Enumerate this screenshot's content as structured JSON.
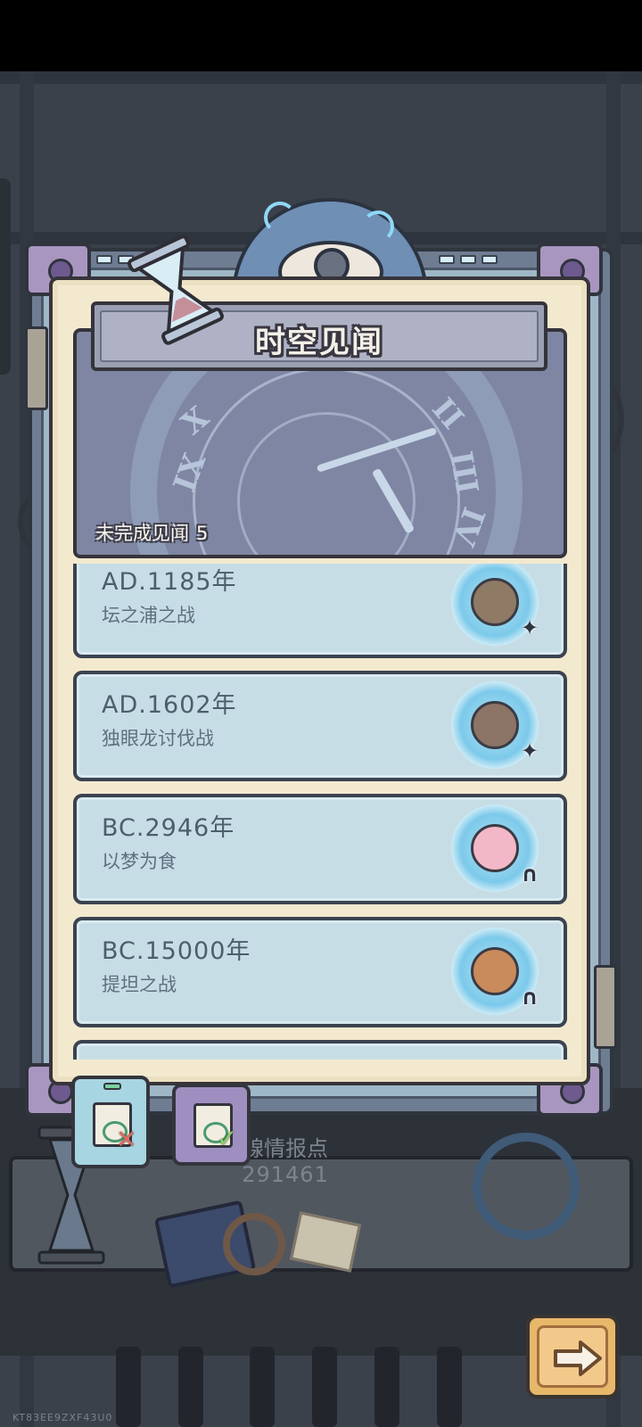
{
  "panel": {
    "title": "时空见闻",
    "incomplete_label": "未完成见闻",
    "incomplete_count": "5"
  },
  "events": [
    {
      "year": "AD.1185年",
      "name": "坛之浦之战",
      "avatar": "samurai-warrior-avatar",
      "type_icon": "shuriken-icon",
      "avatar_color": "#8f7a66"
    },
    {
      "year": "AD.1602年",
      "name": "独眼龙讨伐战",
      "avatar": "one-eyed-warlord-avatar",
      "type_icon": "shuriken-icon",
      "avatar_color": "#8c7467"
    },
    {
      "year": "BC.2946年",
      "name": "以梦为食",
      "avatar": "pink-dream-beast-avatar",
      "type_icon": "horseshoe-icon",
      "avatar_color": "#f2b8c7"
    },
    {
      "year": "BC.15000年",
      "name": "提坦之战",
      "avatar": "crowned-goddess-avatar",
      "type_icon": "horseshoe-icon",
      "avatar_color": "#c98a5c"
    }
  ],
  "intel": {
    "label": "線情报点",
    "value": "291461"
  },
  "tabs": {
    "unfinished": "unfinished-records-tab",
    "finished": "finished-records-tab"
  },
  "next_button": "arrow-right-icon",
  "build_id": "KT83EE9ZXF43U0",
  "colors": {
    "panel_bg": "#f3e9cf",
    "card_bg": "#c7dde6",
    "accent_next": "#e7b76a",
    "tab_unfinished": "#a8d5e2",
    "tab_finished": "#9e8fc0"
  }
}
